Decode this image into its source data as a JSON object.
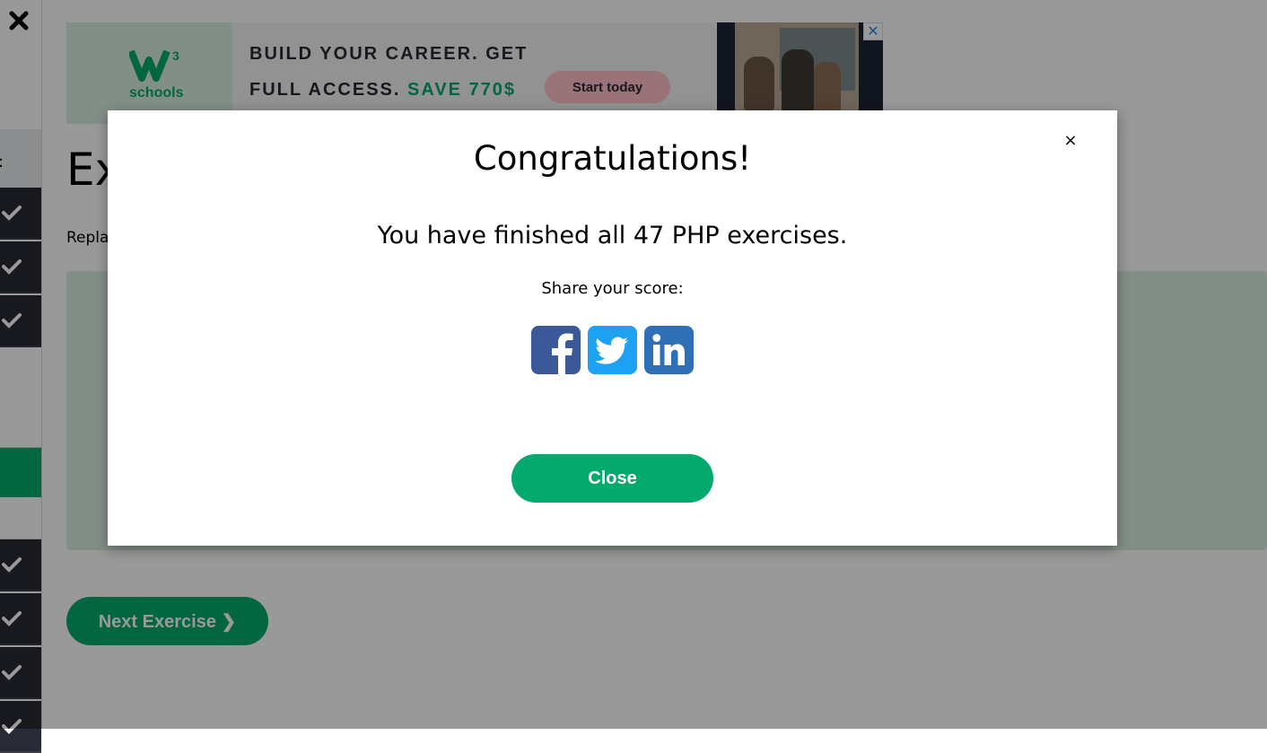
{
  "sidebar": {
    "close_icon": "close-icon",
    "partial_label": ":"
  },
  "ad": {
    "logo_text": "schools",
    "logo_sup": "3",
    "line1": "BUILD YOUR CAREER. GET",
    "line2_prefix": "FULL ACCESS.",
    "line2_accent": "SAVE 770$",
    "cta": "Start today",
    "close_symbol": "✕",
    "accent_color": "#04aa6d"
  },
  "page": {
    "title_partial": "Ex",
    "instruction_partial": "Repla",
    "next_button": "Next Exercise ❯"
  },
  "modal": {
    "close_symbol": "×",
    "title": "Congratulations!",
    "message": "You have finished all 47 PHP exercises.",
    "share_label": "Share your score:",
    "close_button": "Close",
    "socials": [
      {
        "name": "facebook",
        "color": "#3b5998"
      },
      {
        "name": "twitter",
        "color": "#1da1f2"
      },
      {
        "name": "linkedin",
        "color": "#2f6fb5"
      }
    ]
  }
}
